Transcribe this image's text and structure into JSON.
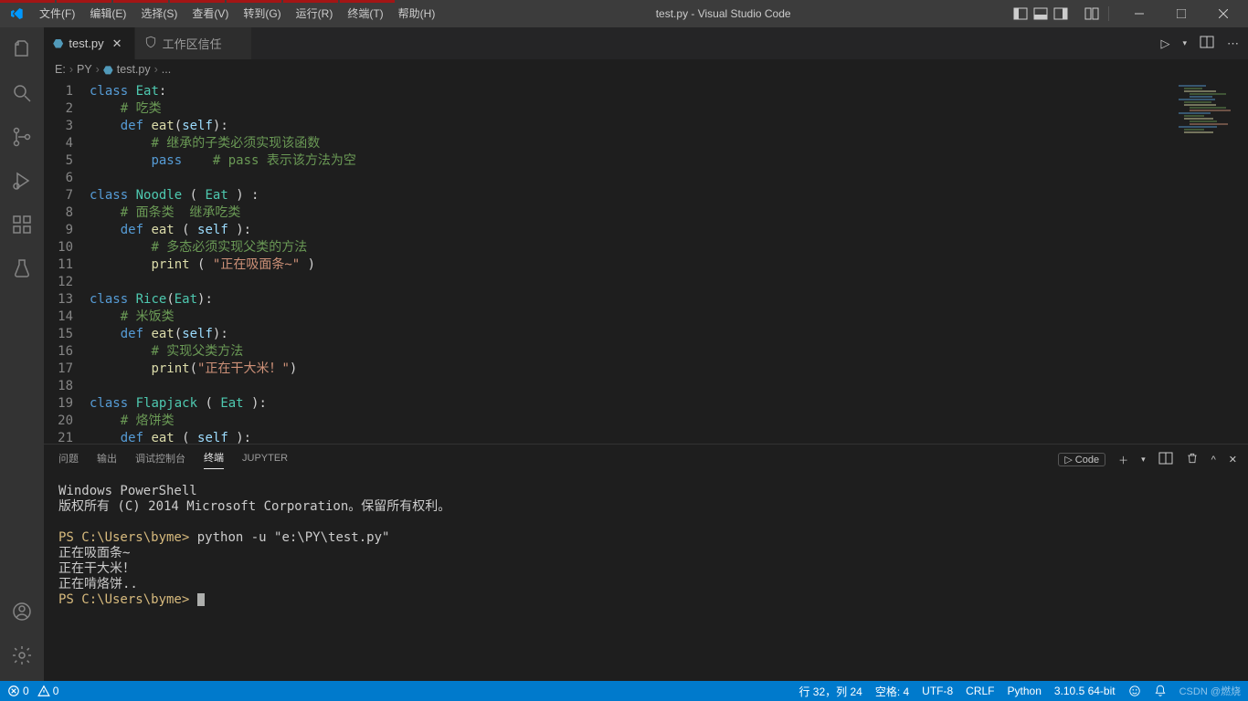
{
  "window": {
    "title": "test.py - Visual Studio Code",
    "menu": [
      "文件(F)",
      "编辑(E)",
      "选择(S)",
      "查看(V)",
      "转到(G)",
      "运行(R)",
      "终端(T)",
      "帮助(H)"
    ]
  },
  "tabs": {
    "active": {
      "label": "test.py"
    },
    "trust": {
      "label": "工作区信任"
    }
  },
  "breadcrumbs": [
    "E:",
    "PY",
    "test.py",
    "..."
  ],
  "code": {
    "lines": [
      [
        [
          "kw",
          "class"
        ],
        [
          "pn",
          " "
        ],
        [
          "cls",
          "Eat"
        ],
        [
          "pn",
          ":"
        ]
      ],
      [
        [
          "pn",
          "    "
        ],
        [
          "cm",
          "# 吃类"
        ]
      ],
      [
        [
          "pn",
          "    "
        ],
        [
          "kw",
          "def"
        ],
        [
          "pn",
          " "
        ],
        [
          "fn",
          "eat"
        ],
        [
          "pn",
          "("
        ],
        [
          "var",
          "self"
        ],
        [
          "pn",
          "):"
        ]
      ],
      [
        [
          "pn",
          "        "
        ],
        [
          "cm",
          "# 继承的子类必须实现该函数"
        ]
      ],
      [
        [
          "pn",
          "        "
        ],
        [
          "kw",
          "pass"
        ],
        [
          "pn",
          "    "
        ],
        [
          "cm",
          "# pass 表示该方法为空"
        ]
      ],
      [],
      [
        [
          "kw",
          "class"
        ],
        [
          "pn",
          " "
        ],
        [
          "cls",
          "Noodle"
        ],
        [
          "pn",
          " ( "
        ],
        [
          "cls",
          "Eat"
        ],
        [
          "pn",
          " ) :"
        ]
      ],
      [
        [
          "pn",
          "    "
        ],
        [
          "cm",
          "# 面条类  继承吃类"
        ]
      ],
      [
        [
          "pn",
          "    "
        ],
        [
          "kw",
          "def"
        ],
        [
          "pn",
          " "
        ],
        [
          "fn",
          "eat"
        ],
        [
          "pn",
          " ( "
        ],
        [
          "var",
          "self"
        ],
        [
          "pn",
          " ):"
        ]
      ],
      [
        [
          "pn",
          "        "
        ],
        [
          "cm",
          "# 多态必须实现父类的方法"
        ]
      ],
      [
        [
          "pn",
          "        "
        ],
        [
          "fn",
          "print"
        ],
        [
          "pn",
          " ( "
        ],
        [
          "str",
          "\"正在吸面条~\""
        ],
        [
          "pn",
          " )"
        ]
      ],
      [],
      [
        [
          "kw",
          "class"
        ],
        [
          "pn",
          " "
        ],
        [
          "cls",
          "Rice"
        ],
        [
          "pn",
          "("
        ],
        [
          "cls",
          "Eat"
        ],
        [
          "pn",
          "):"
        ]
      ],
      [
        [
          "pn",
          "    "
        ],
        [
          "cm",
          "# 米饭类"
        ]
      ],
      [
        [
          "pn",
          "    "
        ],
        [
          "kw",
          "def"
        ],
        [
          "pn",
          " "
        ],
        [
          "fn",
          "eat"
        ],
        [
          "pn",
          "("
        ],
        [
          "var",
          "self"
        ],
        [
          "pn",
          "):"
        ]
      ],
      [
        [
          "pn",
          "        "
        ],
        [
          "cm",
          "# 实现父类方法"
        ]
      ],
      [
        [
          "pn",
          "        "
        ],
        [
          "fn",
          "print"
        ],
        [
          "pn",
          "("
        ],
        [
          "str",
          "\"正在干大米！\""
        ],
        [
          "pn",
          ")"
        ]
      ],
      [],
      [
        [
          "kw",
          "class"
        ],
        [
          "pn",
          " "
        ],
        [
          "cls",
          "Flapjack"
        ],
        [
          "pn",
          " ( "
        ],
        [
          "cls",
          "Eat"
        ],
        [
          "pn",
          " ):"
        ]
      ],
      [
        [
          "pn",
          "    "
        ],
        [
          "cm",
          "# 烙饼类"
        ]
      ],
      [
        [
          "pn",
          "    "
        ],
        [
          "kw",
          "def"
        ],
        [
          "pn",
          " "
        ],
        [
          "fn",
          "eat"
        ],
        [
          "pn",
          " ( "
        ],
        [
          "var",
          "self"
        ],
        [
          "pn",
          " ):"
        ]
      ]
    ]
  },
  "panel": {
    "tabs": [
      "问题",
      "输出",
      "调试控制台",
      "终端",
      "JUPYTER"
    ],
    "active_index": 3,
    "launch_label": "Code",
    "terminal_lines": [
      "Windows PowerShell",
      "版权所有 (C) 2014 Microsoft Corporation。保留所有权利。",
      "",
      {
        "prompt": "PS C:\\Users\\byme>",
        "cmd": " python -u \"e:\\PY\\test.py\""
      },
      "正在吸面条~",
      "正在干大米！",
      "正在啃烙饼..",
      {
        "prompt": "PS C:\\Users\\byme>",
        "cursor": true
      }
    ]
  },
  "status": {
    "errors": "0",
    "warnings": "0",
    "ln_col": "行 32，列 24",
    "spaces": "空格: 4",
    "encoding": "UTF-8",
    "eol": "CRLF",
    "lang": "Python",
    "interpreter": "3.10.5 64-bit",
    "watermark": "CSDN @燃烧"
  }
}
